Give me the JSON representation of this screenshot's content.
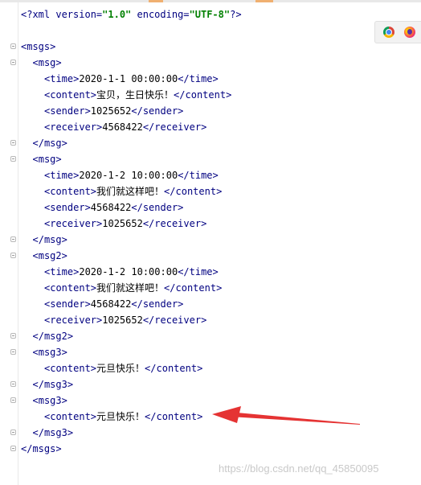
{
  "editor": {
    "lines": [
      [
        {
          "t": "<?",
          "c": "t"
        },
        {
          "t": "xml version=",
          "c": "t"
        },
        {
          "t": "\"1.0\"",
          "c": "v"
        },
        {
          "t": " encoding=",
          "c": "t"
        },
        {
          "t": "\"UTF-8\"",
          "c": "v"
        },
        {
          "t": "?>",
          "c": "t"
        }
      ],
      [],
      [
        {
          "t": "<msgs>",
          "c": "t"
        }
      ],
      [
        {
          "t": "<msg>",
          "c": "t"
        }
      ],
      [
        {
          "t": "<time>",
          "c": "t"
        },
        {
          "t": "2020-1-1 00:00:00",
          "c": "x"
        },
        {
          "t": "</time>",
          "c": "t"
        }
      ],
      [
        {
          "t": "<content>",
          "c": "t"
        },
        {
          "t": "宝贝，生日快乐！",
          "c": "x"
        },
        {
          "t": "</content>",
          "c": "t"
        }
      ],
      [
        {
          "t": "<sender>",
          "c": "t"
        },
        {
          "t": "1025652",
          "c": "x"
        },
        {
          "t": "</sender>",
          "c": "t"
        }
      ],
      [
        {
          "t": "<receiver>",
          "c": "t"
        },
        {
          "t": "4568422",
          "c": "x"
        },
        {
          "t": "</receiver>",
          "c": "t"
        }
      ],
      [
        {
          "t": "</msg>",
          "c": "t"
        }
      ],
      [
        {
          "t": "<msg>",
          "c": "t"
        }
      ],
      [
        {
          "t": "<time>",
          "c": "t"
        },
        {
          "t": "2020-1-2 10:00:00",
          "c": "x"
        },
        {
          "t": "</time>",
          "c": "t"
        }
      ],
      [
        {
          "t": "<content>",
          "c": "t"
        },
        {
          "t": "我们就这样吧！",
          "c": "x"
        },
        {
          "t": "</content>",
          "c": "t"
        }
      ],
      [
        {
          "t": "<sender>",
          "c": "t"
        },
        {
          "t": "4568422",
          "c": "x"
        },
        {
          "t": "</sender>",
          "c": "t"
        }
      ],
      [
        {
          "t": "<receiver>",
          "c": "t"
        },
        {
          "t": "1025652",
          "c": "x"
        },
        {
          "t": "</receiver>",
          "c": "t"
        }
      ],
      [
        {
          "t": "</msg>",
          "c": "t"
        }
      ],
      [
        {
          "t": "<msg2>",
          "c": "t"
        }
      ],
      [
        {
          "t": "<time>",
          "c": "t"
        },
        {
          "t": "2020-1-2 10:00:00",
          "c": "x"
        },
        {
          "t": "</time>",
          "c": "t"
        }
      ],
      [
        {
          "t": "<content>",
          "c": "t"
        },
        {
          "t": "我们就这样吧！",
          "c": "x"
        },
        {
          "t": "</content>",
          "c": "t"
        }
      ],
      [
        {
          "t": "<sender>",
          "c": "t"
        },
        {
          "t": "4568422",
          "c": "x"
        },
        {
          "t": "</sender>",
          "c": "t"
        }
      ],
      [
        {
          "t": "<receiver>",
          "c": "t"
        },
        {
          "t": "1025652",
          "c": "x"
        },
        {
          "t": "</receiver>",
          "c": "t"
        }
      ],
      [
        {
          "t": "</msg2>",
          "c": "t"
        }
      ],
      [
        {
          "t": "<msg3>",
          "c": "t"
        }
      ],
      [
        {
          "t": "<content>",
          "c": "t"
        },
        {
          "t": "元旦快乐！",
          "c": "x"
        },
        {
          "t": "</content>",
          "c": "t"
        }
      ],
      [
        {
          "t": "</msg3>",
          "c": "t"
        }
      ],
      [
        {
          "t": "<msg3>",
          "c": "t"
        }
      ],
      [
        {
          "t": "<content>",
          "c": "t"
        },
        {
          "t": "元旦快乐！",
          "c": "x"
        },
        {
          "t": "</content>",
          "c": "t"
        }
      ],
      [
        {
          "t": "</msg3>",
          "c": "t"
        }
      ],
      [
        {
          "t": "</msgs>",
          "c": "t"
        }
      ],
      []
    ],
    "indents": [
      0,
      0,
      0,
      1,
      2,
      2,
      2,
      2,
      1,
      1,
      2,
      2,
      2,
      2,
      1,
      1,
      2,
      2,
      2,
      2,
      1,
      1,
      2,
      1,
      1,
      2,
      1,
      0,
      0
    ],
    "folds": [
      false,
      false,
      true,
      true,
      false,
      false,
      false,
      false,
      true,
      true,
      false,
      false,
      false,
      false,
      true,
      true,
      false,
      false,
      false,
      false,
      true,
      true,
      false,
      true,
      true,
      false,
      true,
      true,
      false
    ],
    "current_line": 29
  },
  "colors": {
    "tag": "#000080",
    "attr_value": "#008000",
    "text": "#000000",
    "current_line": "#fefbe6",
    "arrow": "#e53333"
  },
  "browser_icons": [
    "chrome-icon",
    "firefox-icon"
  ],
  "watermark": "https://blog.csdn.net/qq_45850095"
}
